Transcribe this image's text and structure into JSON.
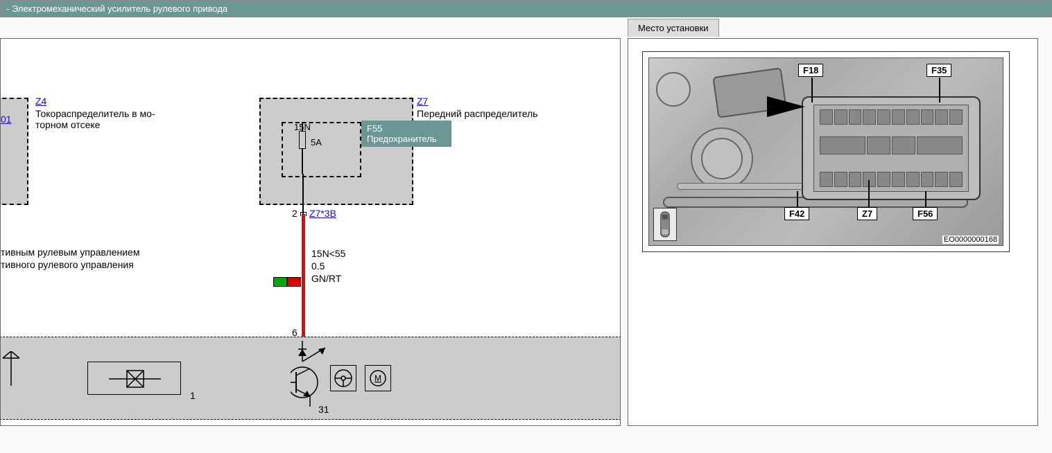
{
  "header": {
    "title": "-  Электромеханический усилитель рулевого привода"
  },
  "tab": {
    "label": "Место установки"
  },
  "diagram": {
    "z4_link": "Z4",
    "z4_desc1": "Токораспределитель в мо-",
    "z4_desc2": "торном отсеке",
    "left_link_trunc": "01",
    "z7_link": "Z7",
    "z7_desc": "Передний распределитель",
    "fuse_id": "F55",
    "fuse_desc": "Предохранитель",
    "fuse_pin_top": "15N",
    "fuse_rating": "5A",
    "conn_label": "Z7*3B",
    "pin2": "2",
    "pin6": "6",
    "wire_label1": "15N<55",
    "wire_label2": "0.5",
    "wire_label3": "GN/RT",
    "trunc1": "тивным рулевым управлением",
    "trunc2": "тивного рулевого управления",
    "bottom_num1": "1",
    "bottom_num31": "31"
  },
  "photo": {
    "callouts": {
      "f18": "F18",
      "f35": "F35",
      "f42": "F42",
      "z7": "Z7",
      "f56": "F56"
    },
    "image_id": "EO0000000168"
  }
}
